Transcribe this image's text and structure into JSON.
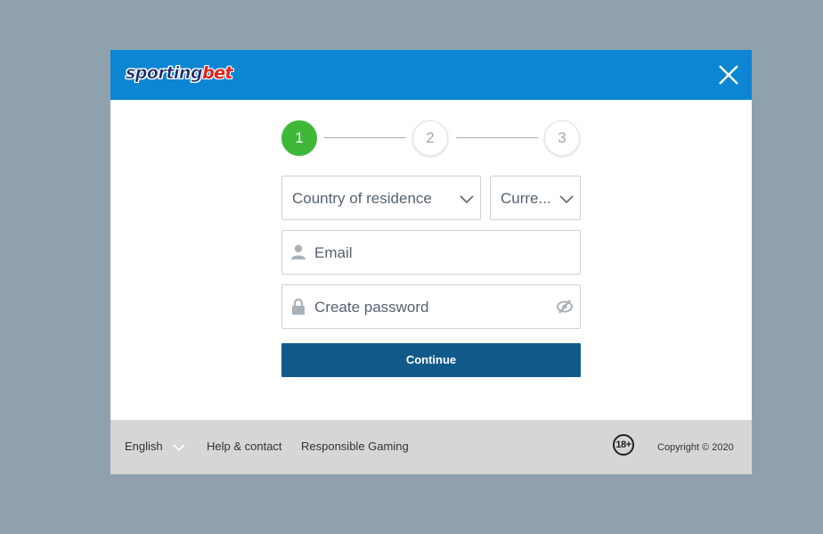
{
  "header": {
    "logo": {
      "part1": "sporting",
      "part2": "bet"
    },
    "close_icon": "close-icon"
  },
  "steps": [
    {
      "number": "1",
      "state": "active"
    },
    {
      "number": "2",
      "state": "inactive"
    },
    {
      "number": "3",
      "state": "inactive"
    }
  ],
  "form": {
    "country_select": {
      "placeholder": "Country of residence"
    },
    "currency_select": {
      "placeholder": "Curre..."
    },
    "email_field": {
      "placeholder": "Email",
      "icon": "user-icon"
    },
    "password_field": {
      "placeholder": "Create password",
      "icon": "lock-icon",
      "toggle_icon": "eye-slash-icon"
    },
    "continue_label": "Continue"
  },
  "footer": {
    "language": "English",
    "help": "Help & contact",
    "responsible": "Responsible Gaming",
    "age_badge": "18+",
    "copyright": "Copyright © 2020"
  },
  "colors": {
    "header_bg": "#0c86d3",
    "step_active": "#3fb83a",
    "button_bg": "#0f5a8a",
    "footer_bg": "#d6d6d6",
    "backdrop": "#8fa1ad"
  }
}
